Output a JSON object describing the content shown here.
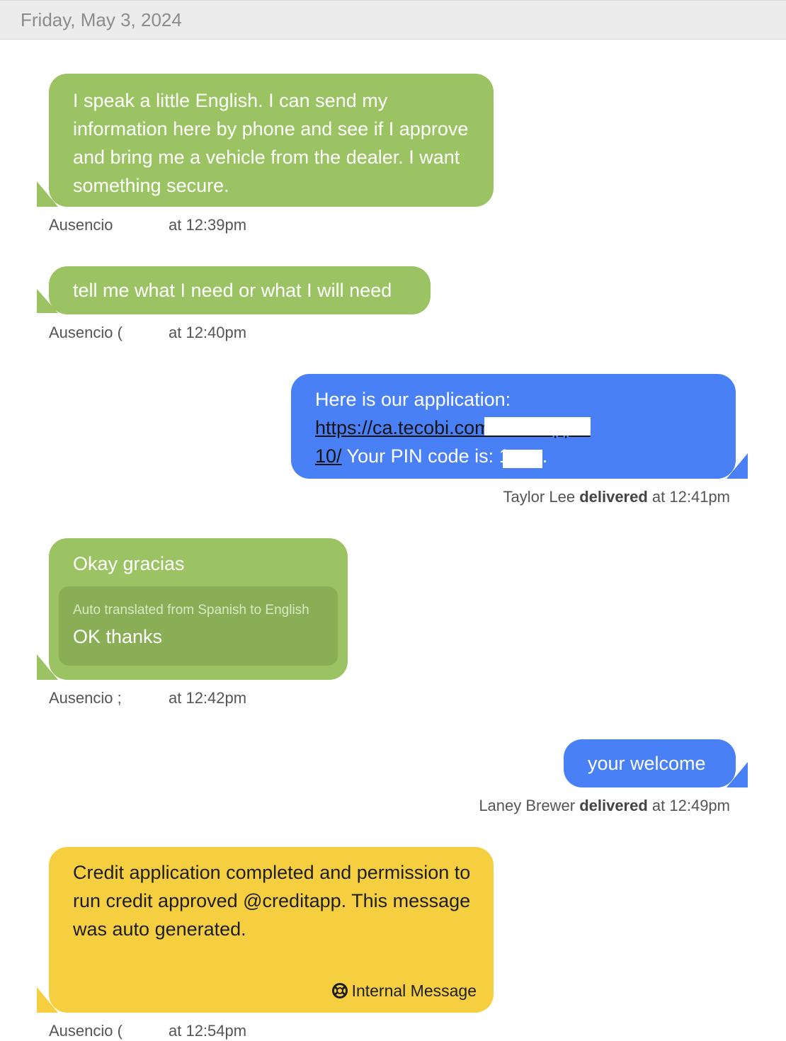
{
  "date_header": "Friday, May 3, 2024",
  "messages": [
    {
      "text": "I speak a little English. I can send my information here by phone and see if I approve and bring me a vehicle from the dealer. I want something secure.",
      "sender": "Ausencio",
      "time": "at 12:39pm"
    },
    {
      "text": "tell me what I need or what I will need",
      "sender": "Ausencio (",
      "time": "at 12:40pm"
    },
    {
      "text_prefix": "Here is our application:",
      "link_part1": "https://ca.tecobi.com/creditapp/1",
      "link_part2": "10/",
      "text_pin": " Your PIN code is: ",
      "pin_visible": "1",
      "text_suffix": ".",
      "sender": "Taylor Lee",
      "status": "delivered",
      "time": "at 12:41pm"
    },
    {
      "text": "Okay gracias",
      "translation_note": "Auto translated from Spanish to English",
      "translation": "OK thanks",
      "sender": "Ausencio ;",
      "time": "at 12:42pm"
    },
    {
      "text": "your welcome",
      "sender": "Laney Brewer",
      "status": "delivered",
      "time": "at 12:49pm"
    },
    {
      "text": "Credit application completed and permission to run credit approved @creditapp. This message was auto generated.",
      "tag": "Internal Message",
      "tag_icon": "lifebuoy-icon",
      "sender": "Ausencio (",
      "time": "at 12:54pm"
    }
  ],
  "colors": {
    "incoming": "#9bc363",
    "outgoing": "#4a80f5",
    "internal": "#f6cf41",
    "translation_box": "#89ae55",
    "header_bg": "#ececec"
  }
}
